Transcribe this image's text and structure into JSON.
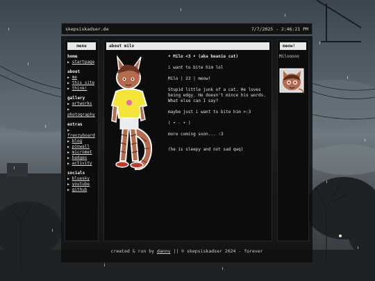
{
  "topbar": {
    "site": "skepsiskadser.de",
    "datetime": "7/7/2025 - 2:46:21 PM"
  },
  "menu": {
    "title": "menu",
    "sections": [
      {
        "title": "home",
        "links": [
          "startpage"
        ]
      },
      {
        "title": "about",
        "links": [
          "me",
          "this site",
          "think!"
        ]
      },
      {
        "title": "gallery",
        "links": [
          "artworks",
          "photography"
        ]
      },
      {
        "title": "extras",
        "links": [
          "frenzyboard",
          "blog",
          "pinwall",
          "micromet",
          "badges",
          "activity"
        ]
      },
      {
        "title": "socials",
        "links": [
          "bluesky",
          "youtube",
          "github"
        ]
      }
    ]
  },
  "content": {
    "title": "about milo",
    "heading": "• Milo <3 • (aka beanie cat)",
    "paragraphs": [
      "i want to bite him lol",
      "Milo | 23 | meow!",
      "Stupid little junk of a cat. He loves being edgy. He doesn't mince his words. What else can I say?",
      "maybe just i want to bite him >:3",
      "( • - • )",
      "more coming soon... :3",
      "(he is sleepy and not sad qwq)"
    ]
  },
  "sidebar_right": {
    "title": "meow!",
    "subtitle": "Milooooo"
  },
  "footer": {
    "prefix": "created & run by",
    "author": "danny",
    "suffix": "|| © skepsiskadser 2024 - forever"
  }
}
